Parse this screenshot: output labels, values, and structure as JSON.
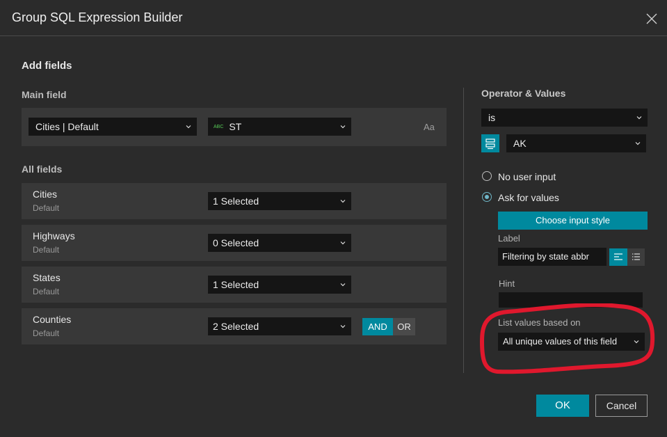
{
  "dialog": {
    "title": "Group SQL Expression Builder"
  },
  "add_fields": {
    "title": "Add fields",
    "main_field_label": "Main field",
    "main_layer": "Cities | Default",
    "main_field_type": "ABC",
    "main_field": "ST",
    "case_toggle": "Aa"
  },
  "all_fields": {
    "label": "All fields",
    "rows": [
      {
        "name": "Cities",
        "sub": "Default",
        "value": "1 Selected"
      },
      {
        "name": "Highways",
        "sub": "Default",
        "value": "0 Selected"
      },
      {
        "name": "States",
        "sub": "Default",
        "value": "1 Selected"
      },
      {
        "name": "Counties",
        "sub": "Default",
        "value": "2 Selected"
      }
    ],
    "and_label": "AND",
    "or_label": "OR"
  },
  "operator": {
    "title": "Operator & Values",
    "operator_value": "is",
    "value": "AK",
    "radio_no_input": "No user input",
    "radio_ask": "Ask for values",
    "choose_style_button": "Choose input style",
    "label_label": "Label",
    "label_value": "Filtering by state abbr",
    "hint_label": "Hint",
    "hint_value": "",
    "list_values_label": "List values based on",
    "list_values_value": "All unique values of this field"
  },
  "footer": {
    "ok": "OK",
    "cancel": "Cancel"
  },
  "colors": {
    "accent": "#00899e",
    "annotation": "#e0182d"
  }
}
